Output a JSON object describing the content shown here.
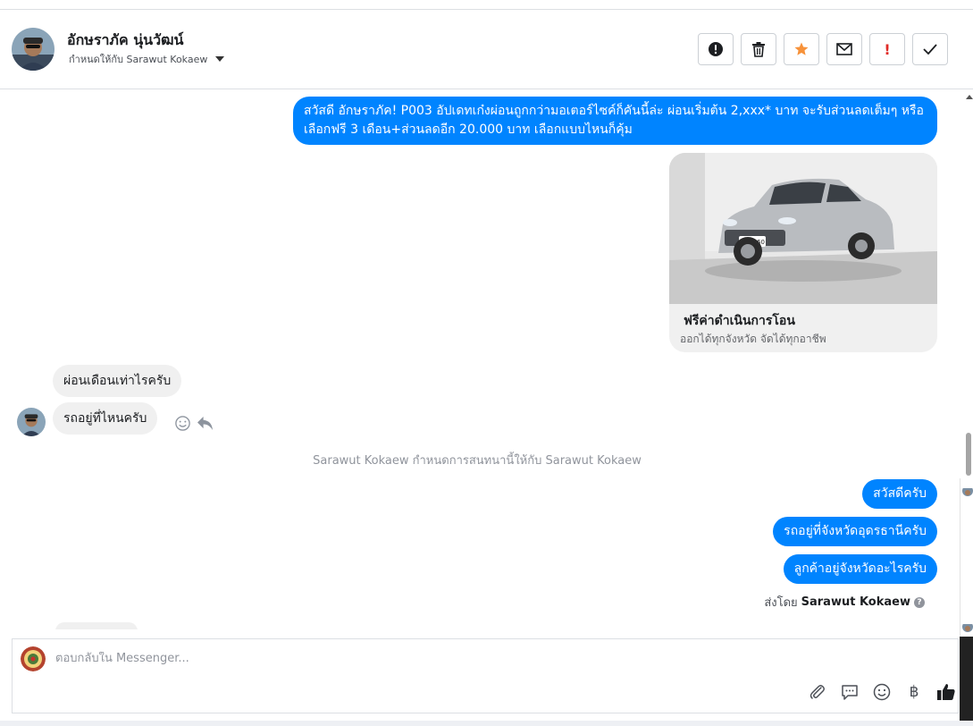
{
  "header": {
    "contact_name": "อักษราภัค นุ่นวัฒน์",
    "assign_label": "กำหนดให้กับ Sarawut Kokaew",
    "actions": [
      {
        "name": "spam-button",
        "icon": "exclamation-circle-icon"
      },
      {
        "name": "delete-button",
        "icon": "trash-icon"
      },
      {
        "name": "star-button",
        "icon": "star-icon",
        "color": "#f7923a"
      },
      {
        "name": "mark-unread-button",
        "icon": "envelope-icon"
      },
      {
        "name": "follow-up-button",
        "label": "!",
        "color": "#e02b27"
      },
      {
        "name": "mark-done-button",
        "icon": "check-icon"
      }
    ]
  },
  "messages": {
    "outgoing_intro": "สวัสดี อักษราภัค! P003 อัปเดทเก๋งผ่อนถูกกว่ามอเตอร์ไซค์ก็คันนี้ล่ะ ผ่อนเริ่มต้น 2,xxx* บาท จะรับส่วนลดเต็มๆ หรือ เลือกฟรี 3 เดือน+ส่วนลดอีก 20.000 บาท เลือกแบบไหนก็คุ้ม",
    "card_plate": "ทิ-4760",
    "card_title": "ฟรีค่าดำเนินการโอน",
    "card_subtitle": "ออกได้ทุกจังหวัด จัดได้ทุกอาชีพ",
    "incoming_1": "ผ่อนเดือนเท่าไรครับ",
    "incoming_2": "รถอยู่ที่ไหนครับ",
    "system_note": "Sarawut Kokaew กำหนดการสนทนานี้ให้กับ Sarawut Kokaew",
    "outgoing_1": "สวัสดีครับ",
    "outgoing_2": "รถอยู่ที่จังหวัดอุดรธานีครับ",
    "outgoing_3": "ลูกค้าอยู่จังหวัดอะไรครับ",
    "sent_by_prefix": "ส่งโดย",
    "sent_by_name": "Sarawut Kokaew"
  },
  "composer": {
    "placeholder": "ตอบกลับใน Messenger...",
    "baht_symbol": "฿"
  },
  "colors": {
    "outgoing_bubble": "#0084ff",
    "incoming_bubble": "#f0f0f0",
    "accent_star": "#f7923a",
    "alert_red": "#e02b27"
  }
}
